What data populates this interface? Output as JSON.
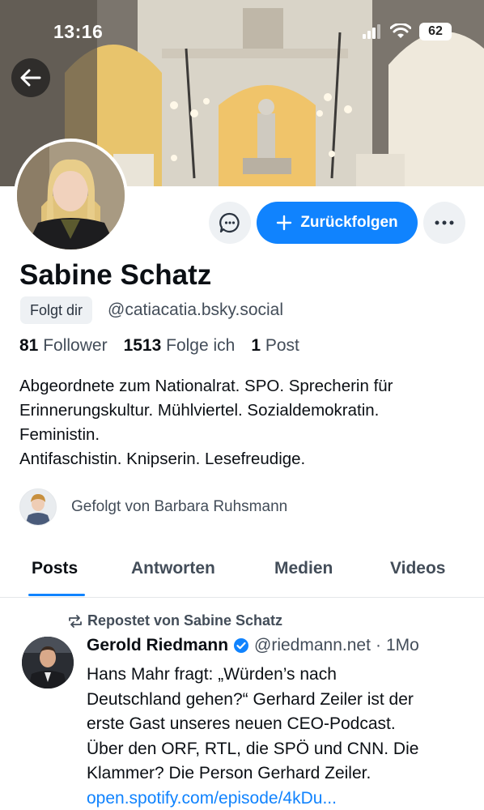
{
  "status_bar": {
    "time": "13:16",
    "battery": "62"
  },
  "profile": {
    "display_name": "Sabine Schatz",
    "follows_you_badge": "Folgt dir",
    "handle": "@catiacatia.bsky.social",
    "followers_count": "81",
    "followers_label": "Follower",
    "following_count": "1513",
    "following_label": "Folge ich",
    "posts_count": "1",
    "posts_label": "Post",
    "bio_lines": [
      "Abgeordnete zum Nationalrat. SPO. Sprecherin für",
      "Erinnerungskultur. Mühlviertel. Sozialdemokratin.",
      "Feministin.",
      "Antifaschistin. Knipserin. Lesefreudige."
    ],
    "followed_by": "Gefolgt von Barbara Ruhsmann"
  },
  "actions": {
    "follow_back_label": "Zurückfolgen"
  },
  "tabs": [
    {
      "label": "Posts",
      "active": true
    },
    {
      "label": "Antworten",
      "active": false
    },
    {
      "label": "Medien",
      "active": false
    },
    {
      "label": "Videos",
      "active": false
    }
  ],
  "post": {
    "repost_label": "Repostet von Sabine Schatz",
    "author_name": "Gerold Riedmann",
    "author_handle": "@riedmann.net",
    "separator": "·",
    "time": "1Mo",
    "body_lines": [
      "Hans Mahr fragt: „Würden’s nach",
      "Deutschland gehen?“ Gerhard Zeiler ist der",
      "erste Gast unseres neuen CEO-Podcast.",
      "Über den ORF, RTL, die SPÖ und CNN. Die",
      "Klammer? Die Person Gerhard Zeiler."
    ],
    "link_text": "open.spotify.com/episode/4kDu..."
  },
  "colors": {
    "accent": "#1083fe",
    "text": "#0b0f14",
    "muted": "#434d59",
    "chip_bg": "#eef1f4"
  }
}
